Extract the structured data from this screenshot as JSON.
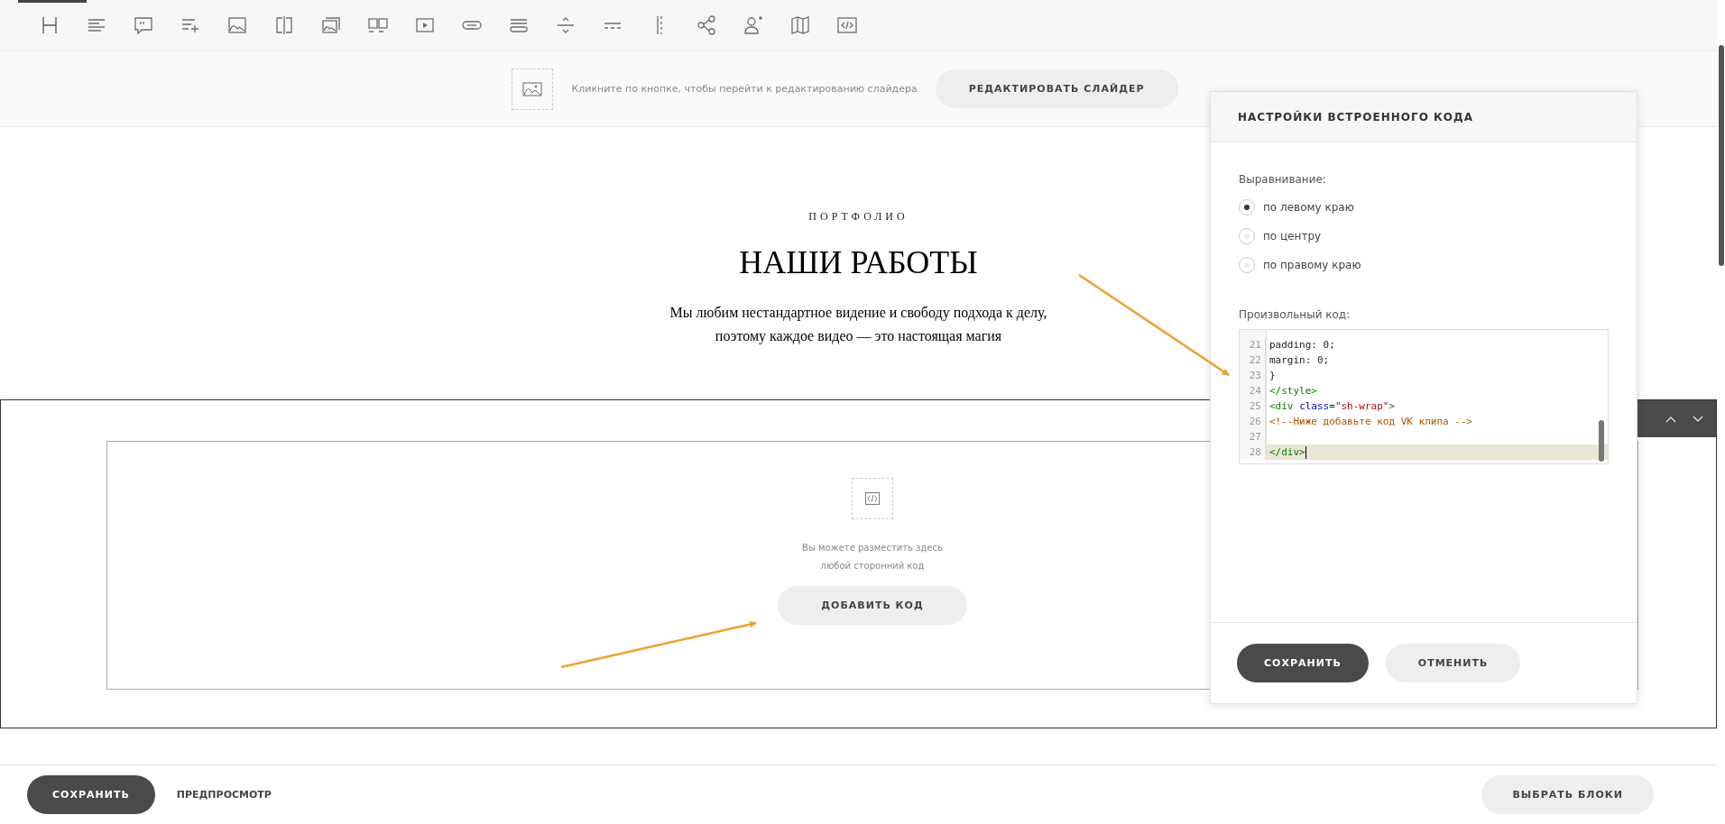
{
  "toolbar": {
    "tools": [
      {
        "kind": "heading",
        "selected": true
      },
      {
        "kind": "text",
        "selected": false
      },
      {
        "kind": "quote",
        "selected": false
      },
      {
        "kind": "list",
        "selected": false
      },
      {
        "kind": "image",
        "selected": false
      },
      {
        "kind": "split",
        "selected": false
      },
      {
        "kind": "gallery",
        "selected": false
      },
      {
        "kind": "image-pair",
        "selected": false
      },
      {
        "kind": "video",
        "selected": false
      },
      {
        "kind": "button",
        "selected": false
      },
      {
        "kind": "lines",
        "selected": false
      },
      {
        "kind": "spacer",
        "selected": false
      },
      {
        "kind": "dashed",
        "selected": false
      },
      {
        "kind": "column",
        "selected": false
      },
      {
        "kind": "share",
        "selected": false
      },
      {
        "kind": "person-add",
        "selected": false
      },
      {
        "kind": "map",
        "selected": false
      },
      {
        "kind": "code",
        "selected": false
      }
    ]
  },
  "slider_strip": {
    "hint": "Кликните по кнопке, чтобы перейти к редактированию слайдера",
    "button": "РЕДАКТИРОВАТЬ СЛАЙДЕР"
  },
  "intro": {
    "eyebrow": "ПОРТФОЛИО",
    "title": "НАШИ РАБОТЫ",
    "lines": [
      "Мы любим нестандартное видение и свободу подхода к делу,",
      "поэтому каждое видео — это настоящая магия"
    ]
  },
  "embed_block": {
    "hint_lines": [
      "Вы можете разместить здесь",
      "любой сторонний код"
    ],
    "button": "ДОБАВИТЬ КОД"
  },
  "settings_panel": {
    "title": "НАСТРОЙКИ ВСТРОЕННОГО КОДА",
    "alignment_label": "Выравнивание:",
    "alignment_options": [
      {
        "label": "по левому краю",
        "selected": true
      },
      {
        "label": "по центру",
        "selected": false
      },
      {
        "label": "по правому краю",
        "selected": false
      }
    ],
    "code_label": "Произвольный код:",
    "code_lines": [
      {
        "number": "21",
        "active": false,
        "tokens": [
          {
            "kind": "plain",
            "text": "padding: 0;"
          }
        ]
      },
      {
        "number": "22",
        "active": false,
        "tokens": [
          {
            "kind": "plain",
            "text": "margin: 0;"
          }
        ]
      },
      {
        "number": "23",
        "active": false,
        "tokens": [
          {
            "kind": "plain",
            "text": "}"
          }
        ]
      },
      {
        "number": "24",
        "active": false,
        "tokens": [
          {
            "kind": "tag",
            "text": "</style>"
          }
        ]
      },
      {
        "number": "25",
        "active": false,
        "tokens": [
          {
            "kind": "tag",
            "text": "<div "
          },
          {
            "kind": "attr",
            "text": "class"
          },
          {
            "kind": "plain",
            "text": "="
          },
          {
            "kind": "string",
            "text": "\"sh-wrap\""
          },
          {
            "kind": "tag",
            "text": ">"
          }
        ]
      },
      {
        "number": "26",
        "active": false,
        "tokens": [
          {
            "kind": "comment",
            "text": "<!--Ниже добавьте код VK клипа -->"
          }
        ]
      },
      {
        "number": "27",
        "active": false
      },
      {
        "number": "28",
        "active": true,
        "tokens": [
          {
            "kind": "tag",
            "text": "</div>"
          }
        ]
      }
    ],
    "buttons": [
      {
        "label": "СОХРАНИТЬ",
        "primary": true
      },
      {
        "label": "ОТМЕНИТЬ",
        "primary": false
      }
    ]
  },
  "bottom_bar": {
    "save": "СОХРАНИТЬ",
    "preview": "ПРЕДПРОСМОТР",
    "choose_blocks": "ВЫБРАТЬ БЛОКИ"
  }
}
